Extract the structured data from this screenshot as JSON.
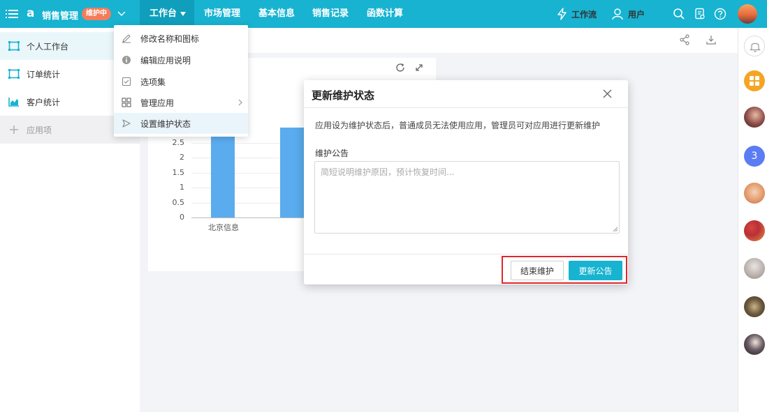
{
  "app": {
    "name": "销售管理",
    "status_badge": "维护中"
  },
  "nav": {
    "tabs": [
      {
        "label": "工作台"
      },
      {
        "label": "市场管理"
      },
      {
        "label": "基本信息"
      },
      {
        "label": "销售记录"
      },
      {
        "label": "函数计算"
      }
    ],
    "workflow_label": "工作流",
    "users_label": "用户"
  },
  "sidebar": {
    "items": [
      {
        "label": "个人工作台"
      },
      {
        "label": "订单统计"
      },
      {
        "label": "客户统计"
      }
    ],
    "add_label": "应用项"
  },
  "dropdown": {
    "items": [
      {
        "label": "修改名称和图标"
      },
      {
        "label": "编辑应用说明"
      },
      {
        "label": "选项集"
      },
      {
        "label": "管理应用"
      },
      {
        "label": "设置维护状态"
      }
    ]
  },
  "chart_data": {
    "type": "bar",
    "categories": [
      "北京信息",
      ""
    ],
    "values": [
      3,
      3
    ],
    "y_ticks": [
      "2.5",
      "2",
      "1.5",
      "1",
      "0.5",
      "0"
    ],
    "ylim": [
      0,
      3
    ]
  },
  "modal": {
    "title": "更新维护状态",
    "description": "应用设为维护状态后，普通成员无法使用应用，管理员可对应用进行更新维护",
    "field_label": "维护公告",
    "placeholder": "简短说明维护原因，预计恢复时间...",
    "value": "",
    "end_button": "结束维护",
    "update_button": "更新公告"
  },
  "right_rail": {
    "badge_number": "3"
  },
  "colors": {
    "brand": "#17b3d1",
    "badge": "#f57c5b",
    "bar": "#5aacee",
    "highlight": "#e0262a"
  }
}
